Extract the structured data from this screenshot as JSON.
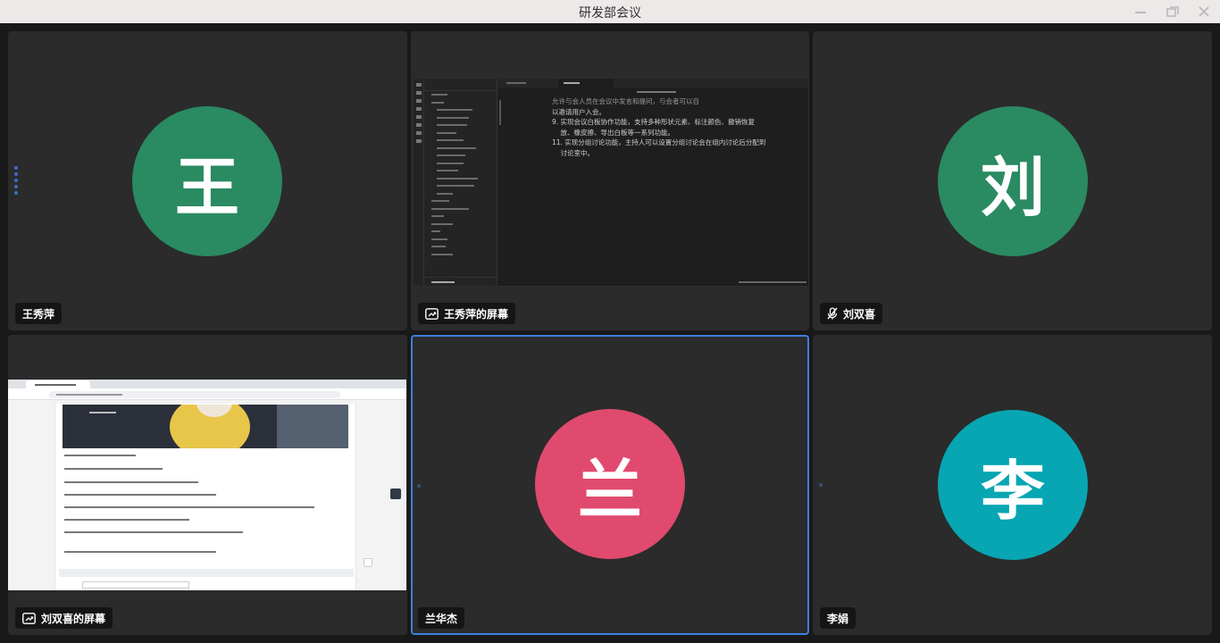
{
  "window": {
    "title": "研发部会议"
  },
  "colors": {
    "active_border": "#3d7fe0",
    "wang": "#2a8a62",
    "liu": "#2a8a62",
    "lan": "#e04a6e",
    "li": "#07a6b2",
    "tile_bg": "#2b2b2b"
  },
  "tiles": [
    {
      "id": "wang",
      "avatar_char": "王",
      "name": "王秀萍",
      "speaking": true
    },
    {
      "id": "wang-screen",
      "name": "王秀萍的屏幕",
      "icon": "screen-share-icon"
    },
    {
      "id": "liu",
      "avatar_char": "刘",
      "name": "刘双喜",
      "icon": "mic-muted-icon"
    },
    {
      "id": "liu-screen",
      "name": "刘双喜的屏幕",
      "icon": "screen-share-icon"
    },
    {
      "id": "lan",
      "avatar_char": "兰",
      "name": "兰华杰",
      "active": true
    },
    {
      "id": "li",
      "avatar_char": "李",
      "name": "李娟"
    }
  ],
  "shared_doc": {
    "lines": [
      "允许与会人员在会议中发言和提问，与会者可以自",
      "以邀请用户入会。",
      "9. 实现会议白板协作功能，支持多种形状元素、标注颜色、撤销恢复",
      "    放、橡皮擦、导出白板等一系列功能。",
      "11. 实现分组讨论功能，主持人可以设置分组讨论会在组内讨论后分配到",
      "    讨论室中。"
    ]
  }
}
